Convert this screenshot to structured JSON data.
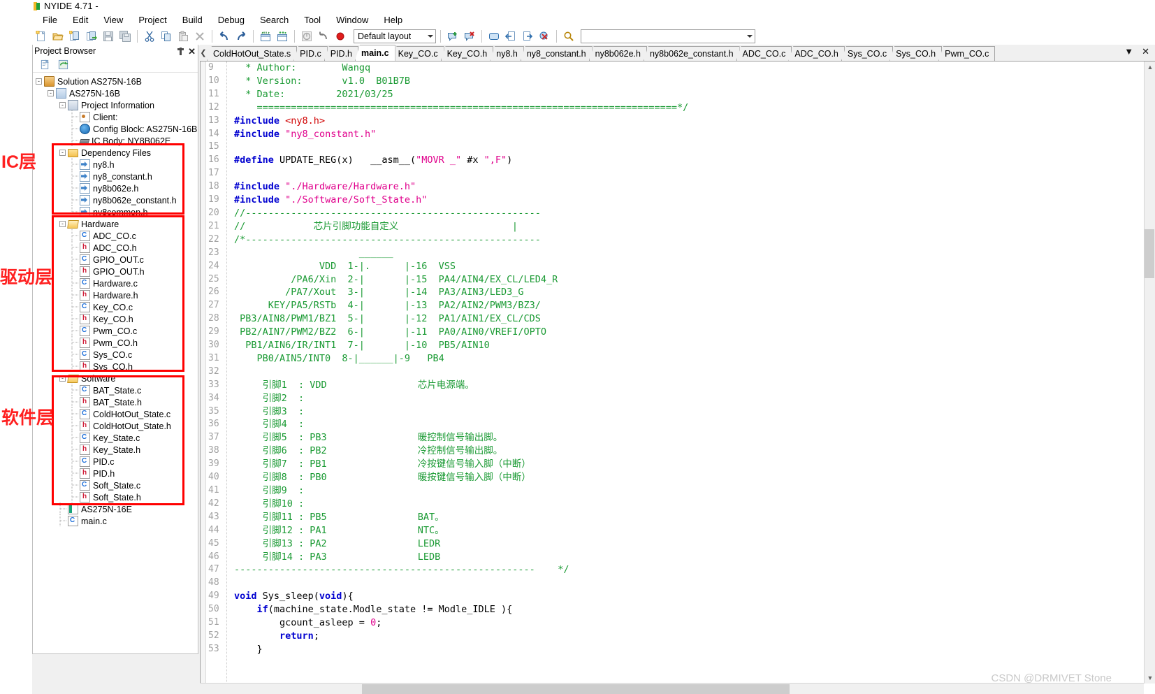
{
  "window": {
    "title": "NYIDE 4.71 -",
    "icon": "nyide-logo-icon"
  },
  "menu": {
    "items": [
      "File",
      "Edit",
      "View",
      "Project",
      "Build",
      "Debug",
      "Search",
      "Tool",
      "Window",
      "Help"
    ]
  },
  "toolbar": {
    "icons": [
      "new-file-icon",
      "open-folder-icon",
      "new-project-icon",
      "import-project-icon",
      "save-icon",
      "save-all-icon",
      "cut-icon",
      "copy-icon",
      "paste-icon",
      "delete-icon",
      "undo-icon",
      "redo-icon",
      "build-icon",
      "rebuild-icon",
      "stop-icon",
      "reset-icon",
      "record-icon"
    ],
    "layout_combo_value": "Default layout",
    "right_icons": [
      "add-comment-icon",
      "remove-comment-icon",
      "window-icon",
      "step-back-icon",
      "step-forward-icon",
      "cancel-search-icon",
      "find-icon"
    ],
    "address_value": ""
  },
  "panel": {
    "title": "Project Browser",
    "pin_icon": "pin-icon",
    "close_icon": "close-icon",
    "tool_icons": [
      "new-item-icon",
      "refresh-icon"
    ]
  },
  "tree": [
    {
      "label": "Solution AS275N-16B",
      "icon": "solution-icon",
      "depth": 0,
      "expander": "-"
    },
    {
      "label": "AS275N-16B",
      "icon": "project-icon",
      "depth": 1,
      "expander": "-"
    },
    {
      "label": "Project Information",
      "icon": "project-info-icon",
      "depth": 2,
      "expander": "-"
    },
    {
      "label": "Client:",
      "icon": "client-icon",
      "depth": 3,
      "expander": ""
    },
    {
      "label": "Config Block: AS275N-16B",
      "icon": "config-block-icon",
      "depth": 3,
      "expander": ""
    },
    {
      "label": "IC Body: NY8B062E",
      "icon": "ic-body-icon",
      "depth": 3,
      "expander": ""
    },
    {
      "label": "Dependency Files",
      "icon": "folder-icon",
      "depth": 2,
      "expander": "-"
    },
    {
      "label": "ny8.h",
      "icon": "dependency-header-icon",
      "depth": 3,
      "expander": ""
    },
    {
      "label": "ny8_constant.h",
      "icon": "dependency-header-icon",
      "depth": 3,
      "expander": ""
    },
    {
      "label": "ny8b062e.h",
      "icon": "dependency-header-icon",
      "depth": 3,
      "expander": ""
    },
    {
      "label": "ny8b062e_constant.h",
      "icon": "dependency-header-icon",
      "depth": 3,
      "expander": ""
    },
    {
      "label": "ny8common.h",
      "icon": "dependency-header-icon",
      "depth": 3,
      "expander": ""
    },
    {
      "label": "Hardware",
      "icon": "folder-open-icon",
      "depth": 2,
      "expander": "-"
    },
    {
      "label": "ADC_CO.c",
      "icon": "c-file-icon",
      "depth": 3,
      "expander": ""
    },
    {
      "label": "ADC_CO.h",
      "icon": "h-file-icon",
      "depth": 3,
      "expander": ""
    },
    {
      "label": "GPIO_OUT.c",
      "icon": "c-file-icon",
      "depth": 3,
      "expander": ""
    },
    {
      "label": "GPIO_OUT.h",
      "icon": "h-file-icon",
      "depth": 3,
      "expander": ""
    },
    {
      "label": "Hardware.c",
      "icon": "c-file-icon",
      "depth": 3,
      "expander": ""
    },
    {
      "label": "Hardware.h",
      "icon": "h-file-icon",
      "depth": 3,
      "expander": ""
    },
    {
      "label": "Key_CO.c",
      "icon": "c-file-icon",
      "depth": 3,
      "expander": ""
    },
    {
      "label": "Key_CO.h",
      "icon": "h-file-icon",
      "depth": 3,
      "expander": ""
    },
    {
      "label": "Pwm_CO.c",
      "icon": "c-file-icon",
      "depth": 3,
      "expander": ""
    },
    {
      "label": "Pwm_CO.h",
      "icon": "h-file-icon",
      "depth": 3,
      "expander": ""
    },
    {
      "label": "Sys_CO.c",
      "icon": "c-file-icon",
      "depth": 3,
      "expander": ""
    },
    {
      "label": "Sys_CO.h",
      "icon": "h-file-icon",
      "depth": 3,
      "expander": ""
    },
    {
      "label": "Software",
      "icon": "folder-open-icon",
      "depth": 2,
      "expander": "-"
    },
    {
      "label": "BAT_State.c",
      "icon": "c-file-icon",
      "depth": 3,
      "expander": ""
    },
    {
      "label": "BAT_State.h",
      "icon": "h-file-icon",
      "depth": 3,
      "expander": ""
    },
    {
      "label": "ColdHotOut_State.c",
      "icon": "c-file-icon",
      "depth": 3,
      "expander": ""
    },
    {
      "label": "ColdHotOut_State.h",
      "icon": "h-file-icon",
      "depth": 3,
      "expander": ""
    },
    {
      "label": "Key_State.c",
      "icon": "c-file-icon",
      "depth": 3,
      "expander": ""
    },
    {
      "label": "Key_State.h",
      "icon": "h-file-icon",
      "depth": 3,
      "expander": ""
    },
    {
      "label": "PID.c",
      "icon": "c-file-icon",
      "depth": 3,
      "expander": ""
    },
    {
      "label": "PID.h",
      "icon": "h-file-icon",
      "depth": 3,
      "expander": ""
    },
    {
      "label": "Soft_State.c",
      "icon": "c-file-icon",
      "depth": 3,
      "expander": ""
    },
    {
      "label": "Soft_State.h",
      "icon": "h-file-icon",
      "depth": 3,
      "expander": ""
    },
    {
      "label": "AS275N-16E",
      "icon": "listing-icon",
      "depth": 2,
      "expander": ""
    },
    {
      "label": "main.c",
      "icon": "c-file-icon",
      "depth": 2,
      "expander": ""
    }
  ],
  "annotations": [
    {
      "label": "IC层",
      "color": "#ff2020"
    },
    {
      "label": "驱动层",
      "color": "#ff2020"
    },
    {
      "label": "软件层",
      "color": "#ff2020"
    }
  ],
  "tabs": [
    {
      "label": "ColdHotOut_State.s",
      "active": false
    },
    {
      "label": "PID.c",
      "active": false
    },
    {
      "label": "PID.h",
      "active": false
    },
    {
      "label": "main.c",
      "active": true
    },
    {
      "label": "Key_CO.c",
      "active": false
    },
    {
      "label": "Key_CO.h",
      "active": false
    },
    {
      "label": "ny8.h",
      "active": false
    },
    {
      "label": "ny8_constant.h",
      "active": false
    },
    {
      "label": "ny8b062e.h",
      "active": false
    },
    {
      "label": "ny8b062e_constant.h",
      "active": false
    },
    {
      "label": "ADC_CO.c",
      "active": false
    },
    {
      "label": "ADC_CO.h",
      "active": false
    },
    {
      "label": "Sys_CO.c",
      "active": false
    },
    {
      "label": "Sys_CO.h",
      "active": false
    },
    {
      "label": "Pwm_CO.c",
      "active": false
    }
  ],
  "tabbar_controls": {
    "list_icon": "tab-list-icon",
    "close_icon": "close-tab-icon",
    "scroll_left_icon": "scroll-left-icon"
  },
  "editor": {
    "first_line_number": 9,
    "last_line_number": 53,
    "lines": [
      {
        "n": 9,
        "html": "  <span class=\"cm\">* Author:        Wangq</span>"
      },
      {
        "n": 10,
        "html": "  <span class=\"cm\">* Version:       v1.0  B01B7B</span>"
      },
      {
        "n": 11,
        "html": "  <span class=\"cm\">* Date:         2021/03/25</span>"
      },
      {
        "n": 12,
        "html": "  <span class=\"cm\">  ==========================================================================*/</span>"
      },
      {
        "n": 13,
        "html": "<span class=\"kw\">#include</span> <span class=\"strr\">&lt;ny8.h&gt;</span>"
      },
      {
        "n": 14,
        "html": "<span class=\"kw\">#include</span> <span class=\"str\">\"ny8_constant.h\"</span>"
      },
      {
        "n": 15,
        "html": ""
      },
      {
        "n": 16,
        "html": "<span class=\"kw\">#define</span> UPDATE_REG(x)   __asm__(<span class=\"str\">\"MOVR _\"</span> #x <span class=\"str\">\",F\"</span>)"
      },
      {
        "n": 17,
        "html": ""
      },
      {
        "n": 18,
        "html": "<span class=\"kw\">#include</span> <span class=\"str\">\"./Hardware/Hardware.h\"</span>"
      },
      {
        "n": 19,
        "html": "<span class=\"kw\">#include</span> <span class=\"str\">\"./Software/Soft_State.h\"</span>"
      },
      {
        "n": 20,
        "html": "<span class=\"cm\">//----------------------------------------------------</span>"
      },
      {
        "n": 21,
        "html": "<span class=\"cm\">//            芯片引脚功能自定义                    |</span>"
      },
      {
        "n": 22,
        "html": "<span class=\"cm\">/*----------------------------------------------------</span>"
      },
      {
        "n": 23,
        "html": "<span class=\"cm\">                      ______</span>"
      },
      {
        "n": 24,
        "html": "<span class=\"cm\">               VDD  1-|.      |-16  VSS</span>"
      },
      {
        "n": 25,
        "html": "<span class=\"cm\">          /PA6/Xin  2-|       |-15  PA4/AIN4/EX_CL/LED4_R</span>"
      },
      {
        "n": 26,
        "html": "<span class=\"cm\">         /PA7/Xout  3-|       |-14  PA3/AIN3/LED3_G</span>"
      },
      {
        "n": 27,
        "html": "<span class=\"cm\">      KEY/PA5/RSTb  4-|       |-13  PA2/AIN2/PWM3/BZ3/</span>"
      },
      {
        "n": 28,
        "html": "<span class=\"cm\"> PB3/AIN8/PWM1/BZ1  5-|       |-12  PA1/AIN1/EX_CL/CDS</span>"
      },
      {
        "n": 29,
        "html": "<span class=\"cm\"> PB2/AIN7/PWM2/BZ2  6-|       |-11  PA0/AIN0/VREFI/OPTO</span>"
      },
      {
        "n": 30,
        "html": "<span class=\"cm\">  PB1/AIN6/IR/INT1  7-|       |-10  PB5/AIN10</span>"
      },
      {
        "n": 31,
        "html": "<span class=\"cm\">    PB0/AIN5/INT0  8-|______|-9   PB4</span>"
      },
      {
        "n": 32,
        "html": ""
      },
      {
        "n": 33,
        "html": "<span class=\"cm\">     引脚1  : VDD                芯片电源端。</span>"
      },
      {
        "n": 34,
        "html": "<span class=\"cm\">     引脚2  :</span>"
      },
      {
        "n": 35,
        "html": "<span class=\"cm\">     引脚3  :</span>"
      },
      {
        "n": 36,
        "html": "<span class=\"cm\">     引脚4  :</span>"
      },
      {
        "n": 37,
        "html": "<span class=\"cm\">     引脚5  : PB3                暖控制信号输出脚。</span>"
      },
      {
        "n": 38,
        "html": "<span class=\"cm\">     引脚6  : PB2                冷控制信号输出脚。</span>"
      },
      {
        "n": 39,
        "html": "<span class=\"cm\">     引脚7  : PB1                冷按键信号输入脚（中断）</span>"
      },
      {
        "n": 40,
        "html": "<span class=\"cm\">     引脚8  : PB0                暖按键信号输入脚（中断）</span>"
      },
      {
        "n": 41,
        "html": "<span class=\"cm\">     引脚9  :</span>"
      },
      {
        "n": 42,
        "html": "<span class=\"cm\">     引脚10 :</span>"
      },
      {
        "n": 43,
        "html": "<span class=\"cm\">     引脚11 : PB5                BAT。</span>"
      },
      {
        "n": 44,
        "html": "<span class=\"cm\">     引脚12 : PA1                NTC。</span>"
      },
      {
        "n": 45,
        "html": "<span class=\"cm\">     引脚13 : PA2                LEDR</span>"
      },
      {
        "n": 46,
        "html": "<span class=\"cm\">     引脚14 : PA3                LEDB</span>"
      },
      {
        "n": 47,
        "html": "<span class=\"cm\">-----------------------------------------------------    */</span>"
      },
      {
        "n": 48,
        "html": ""
      },
      {
        "n": 49,
        "html": "<span class=\"kw\">void</span> Sys_sleep(<span class=\"kw\">void</span>){"
      },
      {
        "n": 50,
        "html": "    <span class=\"kw\">if</span>(machine_state.Modle_state != Modle_IDLE ){"
      },
      {
        "n": 51,
        "html": "        gcount_asleep = <span class=\"num\">0</span>;"
      },
      {
        "n": 52,
        "html": "        <span class=\"kw\">return</span>;"
      },
      {
        "n": 53,
        "html": "    }"
      }
    ]
  },
  "watermark": "CSDN @DRMIVET Stone"
}
